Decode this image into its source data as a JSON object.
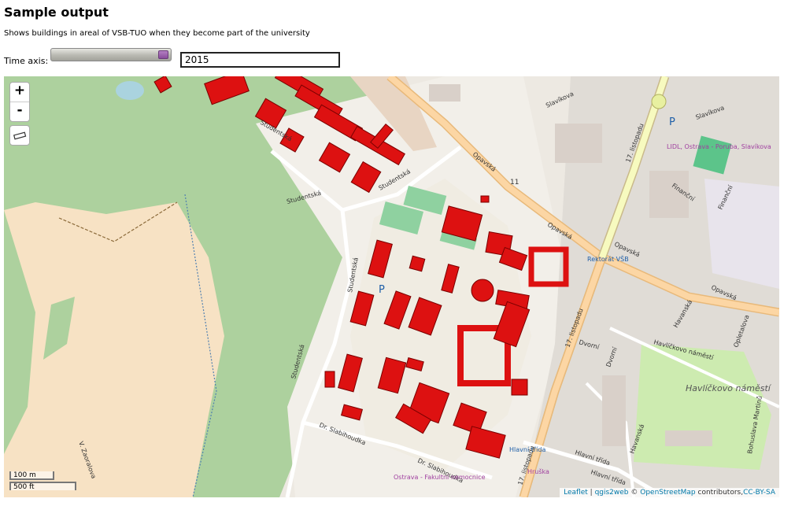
{
  "header": {
    "title": "Sample output",
    "subtitle": "Shows buildings in areal of VSB-TUO when they become part of the university"
  },
  "time_axis": {
    "label": "Time axis:",
    "value": "2015",
    "slider_position": 1.0
  },
  "map": {
    "controls": {
      "zoom_in": "+",
      "zoom_out": "-"
    },
    "scale": {
      "metric": "100 m",
      "imperial": "500 ft"
    },
    "attribution": {
      "leaflet": "Leaflet",
      "sep1": " | ",
      "qgis2web": "qgis2web",
      "sep2": " © ",
      "osm": "OpenStreetMap",
      "contributors": " contributors,",
      "license": "CC-BY-SA"
    },
    "labels": {
      "studentska": "Studentská",
      "opavska": "Opavská",
      "listopadu": "17. listopadu",
      "slavikova": "Slavíkova",
      "lidl": "LIDL, Ostrava - Poruba, Slavíkova",
      "rektorat": "Rektorát VŠB",
      "havlickovo": "Havlíčkovo náměstí",
      "havlickovo_street": "Havlíčkovo náměstí",
      "dvorni": "Dvorní",
      "havanska": "Havanská",
      "opletalova": "Opletalova",
      "finanani": "Finanční",
      "hlavni_trida": "Hlavní třída",
      "hruska": "Hruška",
      "stabihoudka": "Dr. Slabihoudka",
      "nemocnice": "Ostrava - Fakultní nemocnice",
      "zaoralova": "V. Zaoralova",
      "bohuslava": "Bohuslava Martinů",
      "road_number": "11",
      "parking": "P"
    },
    "colors": {
      "building_highlight": "#dd1111",
      "park": "#a8d898",
      "farmland": "#fbe6c0",
      "urban": "#dcd8d0",
      "primary_road": "#fcd6a4",
      "secondary_road": "#f7fabf",
      "water": "#aad3df"
    }
  }
}
